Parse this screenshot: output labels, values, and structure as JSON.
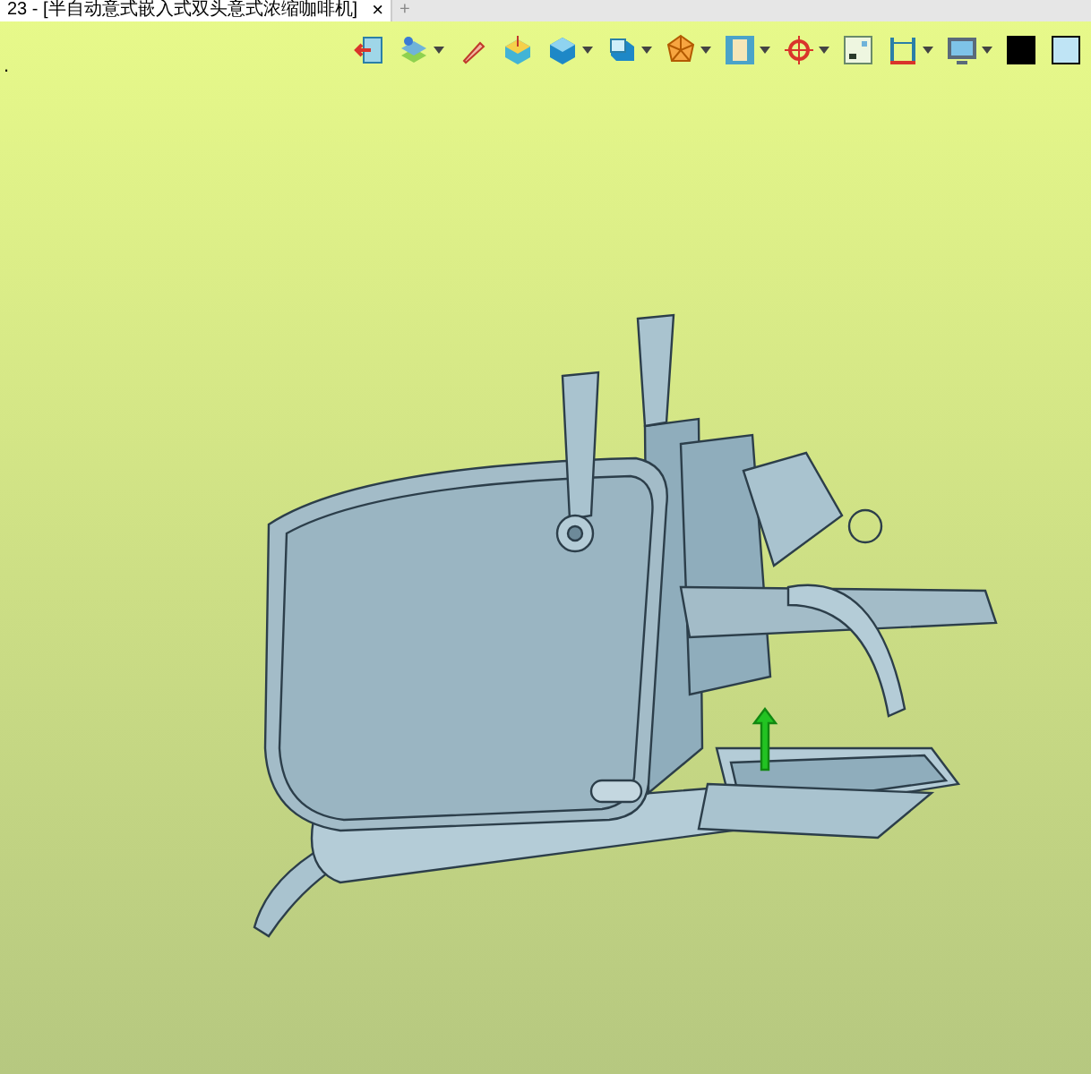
{
  "tabs": [
    {
      "title": "23 - [半自动意式嵌入式双头意式浓缩咖啡机]",
      "selected": true,
      "close": "×"
    },
    {
      "title": "+",
      "selected": false
    }
  ],
  "toolbar": [
    {
      "kind": "exit",
      "menu": false
    },
    {
      "kind": "layers",
      "menu": true
    },
    {
      "kind": "brush",
      "menu": false
    },
    {
      "kind": "plane",
      "menu": false
    },
    {
      "kind": "cube",
      "menu": true
    },
    {
      "kind": "view",
      "menu": true
    },
    {
      "kind": "polyhedron",
      "menu": true
    },
    {
      "kind": "frame",
      "menu": true
    },
    {
      "kind": "target",
      "menu": true
    },
    {
      "kind": "grid",
      "menu": false
    },
    {
      "kind": "measure",
      "menu": true
    },
    {
      "kind": "display",
      "menu": true
    },
    {
      "kind": "swatch",
      "menu": false,
      "color": "#000000"
    },
    {
      "kind": "swatch",
      "menu": false,
      "color": "#bfe4f5"
    }
  ],
  "viewport": {
    "mark": "."
  }
}
